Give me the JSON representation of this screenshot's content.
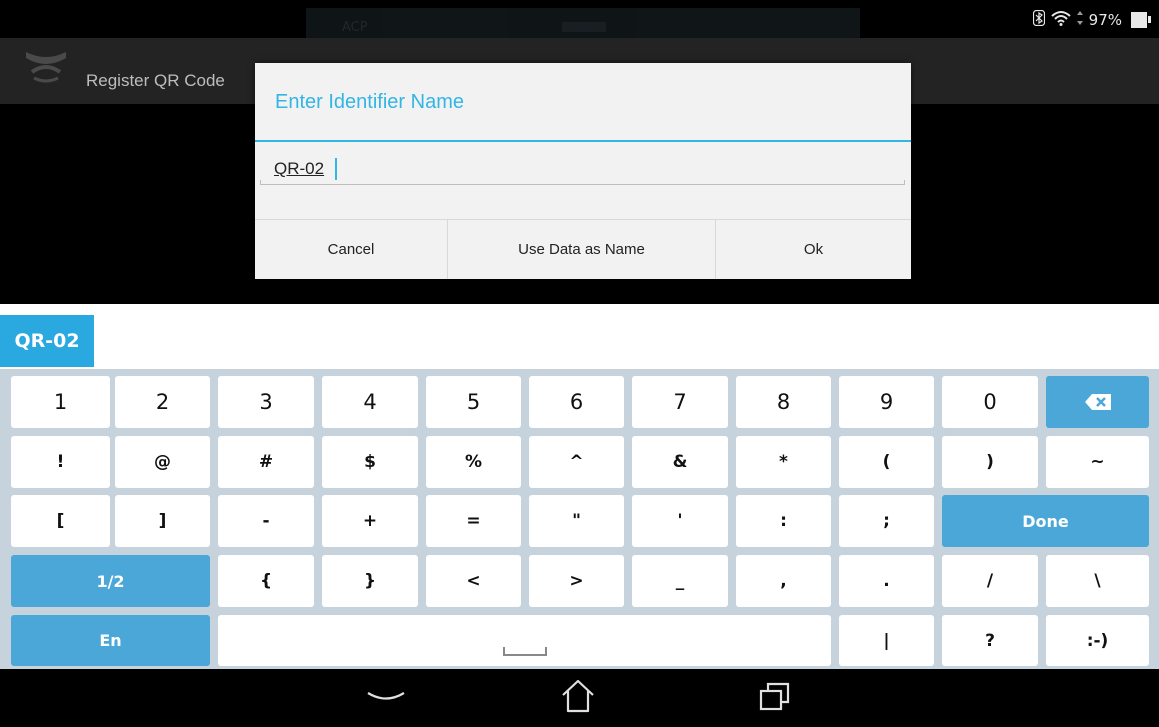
{
  "status_bar": {
    "ghost_text": "ACP",
    "battery": "97%",
    "icons": [
      "bluetooth-icon",
      "wifi-icon",
      "battery-icon"
    ]
  },
  "action_bar": {
    "title": "Register QR Code",
    "logo": "app-logo-icon"
  },
  "dialog": {
    "title": "Enter Identifier Name",
    "input_value": "QR-02",
    "buttons": {
      "cancel": "Cancel",
      "use_data": "Use Data as Name",
      "ok": "Ok"
    }
  },
  "keyboard": {
    "suggestion": "QR-02",
    "rows": [
      [
        "1",
        "2",
        "3",
        "4",
        "5",
        "6",
        "7",
        "8",
        "9",
        "0",
        "⌫"
      ],
      [
        "!",
        "@",
        "#",
        "$",
        "%",
        "^",
        "&",
        "*",
        "(",
        ")",
        "~"
      ],
      [
        "[",
        "]",
        "-",
        "+",
        "=",
        "\"",
        "'",
        ":",
        ";",
        "Done"
      ],
      [
        "1/2",
        "{",
        "}",
        "<",
        ">",
        "_",
        ",",
        ".",
        "/",
        "\\"
      ],
      [
        "En",
        "space",
        "|",
        "?",
        ":-)"
      ]
    ]
  },
  "nav_bar": {
    "icons": [
      "back-icon",
      "home-icon",
      "recents-icon"
    ]
  },
  "colors": {
    "accent": "#33b5e5",
    "key_blue": "#4aa7d8",
    "keyboard_bg": "#c7d3dc"
  }
}
